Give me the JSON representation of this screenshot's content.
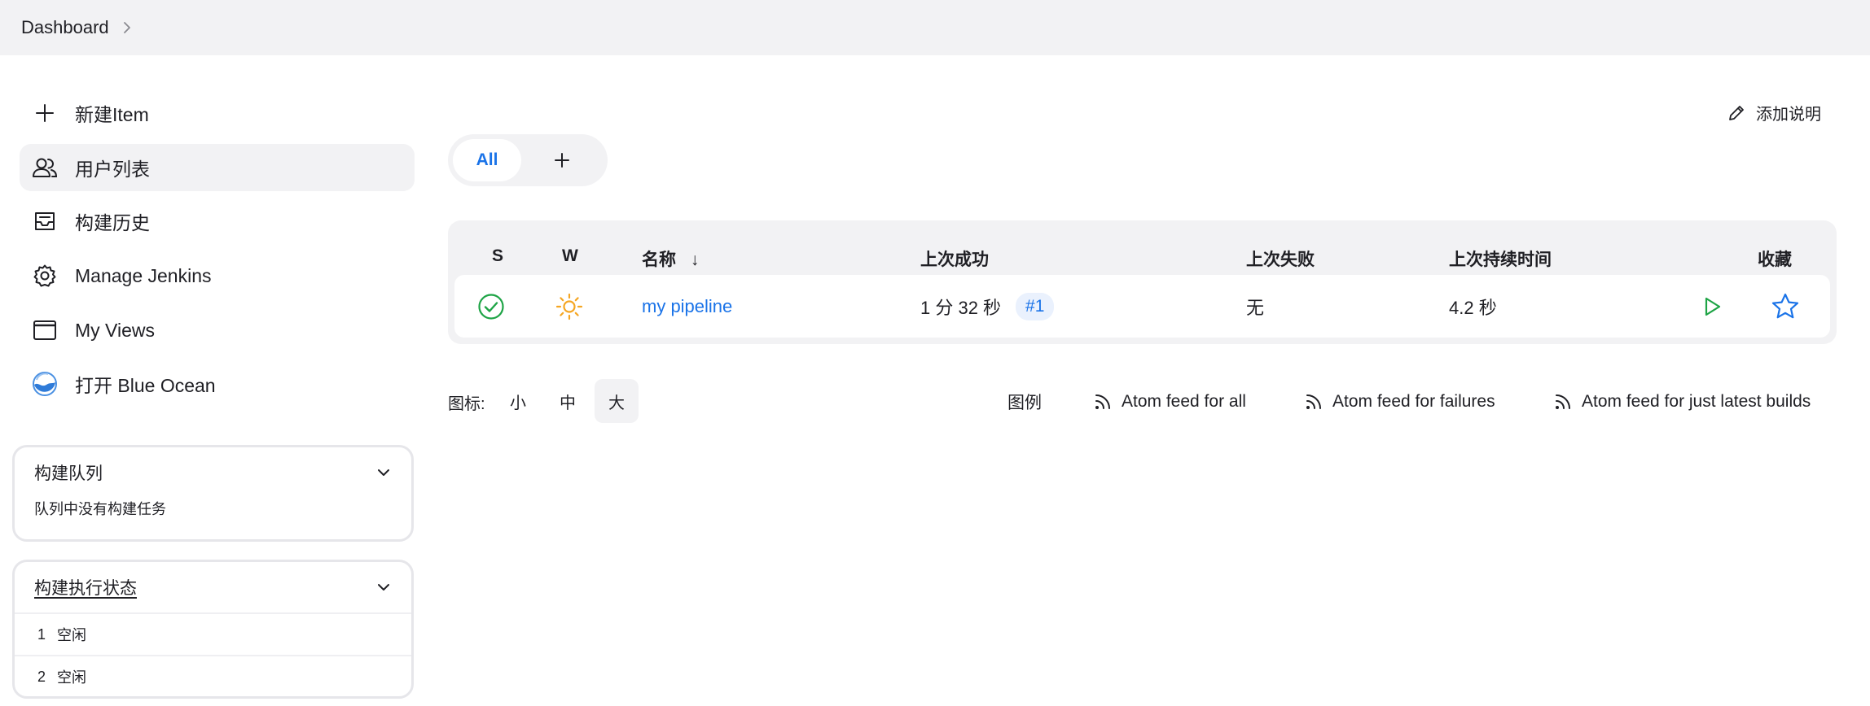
{
  "breadcrumb": {
    "root": "Dashboard"
  },
  "sidebar": {
    "items": [
      {
        "label": "新建Item",
        "icon": "plus-icon"
      },
      {
        "label": "用户列表",
        "icon": "users-icon"
      },
      {
        "label": "构建历史",
        "icon": "inbox-icon"
      },
      {
        "label": "Manage Jenkins",
        "icon": "gear-icon"
      },
      {
        "label": "My Views",
        "icon": "window-icon"
      },
      {
        "label": "打开 Blue Ocean",
        "icon": "blue-ocean-icon"
      }
    ]
  },
  "build_queue": {
    "title": "构建队列",
    "empty_text": "队列中没有构建任务"
  },
  "executors": {
    "title": "构建执行状态",
    "rows": [
      {
        "num": "1",
        "status": "空闲"
      },
      {
        "num": "2",
        "status": "空闲"
      }
    ]
  },
  "main": {
    "add_description": "添加说明",
    "tabs": {
      "all": "All"
    },
    "table": {
      "headers": {
        "s": "S",
        "w": "W",
        "name": "名称",
        "sort_arrow": "↓",
        "last_success": "上次成功",
        "last_failure": "上次失败",
        "last_duration": "上次持续时间",
        "favorite": "收藏"
      },
      "rows": [
        {
          "name": "my pipeline",
          "last_success": "1 分 32 秒",
          "last_success_build": "#1",
          "last_failure": "无",
          "last_duration": "4.2 秒"
        }
      ]
    },
    "footer": {
      "icon_label": "图标:",
      "sizes": [
        "小",
        "中",
        "大"
      ],
      "legend": "图例",
      "feed_all": "Atom feed for all",
      "feed_failures": "Atom feed for failures",
      "feed_latest": "Atom feed for just latest builds"
    }
  },
  "colors": {
    "accent": "#1a73e8",
    "success": "#1ea446",
    "weather": "#f5a623",
    "panel_bg": "#f2f2f4"
  }
}
